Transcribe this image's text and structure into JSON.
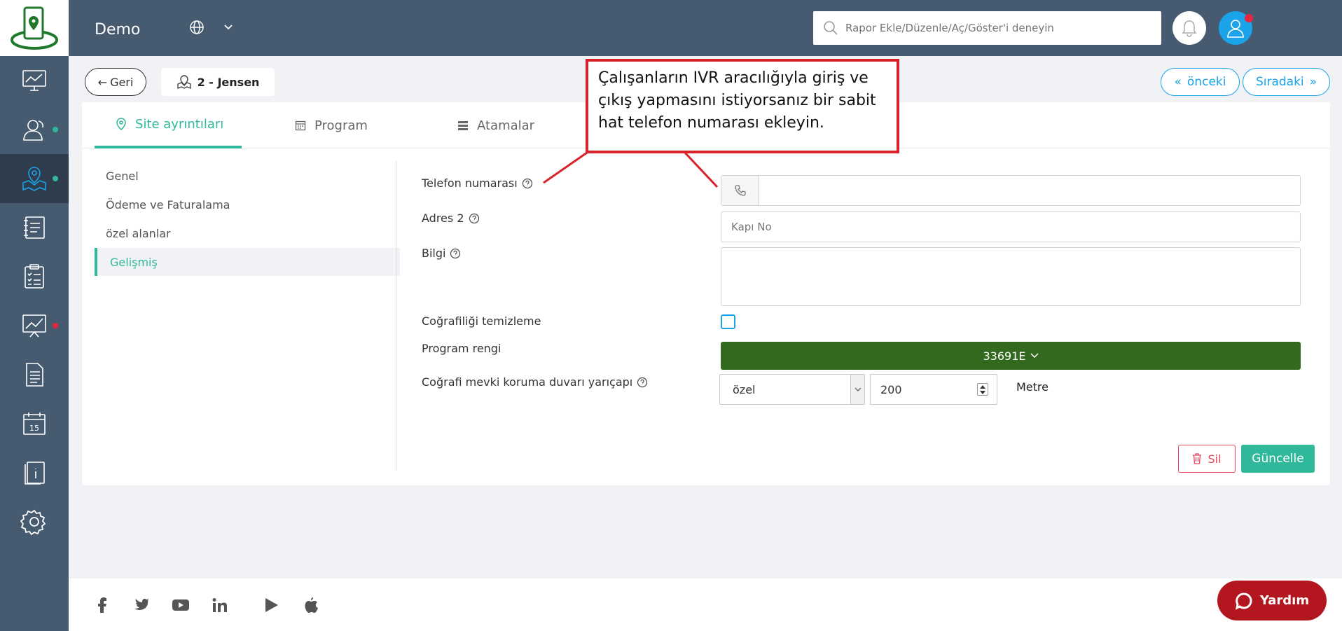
{
  "topbar": {
    "brand": "Demo",
    "search_placeholder": "Rapor Ekle/Düzenle/Aç/Göster'i deneyin"
  },
  "header": {
    "back_label": "Geri",
    "site_name": "2 - Jensen",
    "prev_label": "önceki",
    "next_label": "Sıradaki"
  },
  "tabs": [
    {
      "label": "Site ayrıntıları",
      "icon": "location-pin-icon"
    },
    {
      "label": "Program",
      "icon": "calendar-icon"
    },
    {
      "label": "Atamalar",
      "icon": "list-icon"
    }
  ],
  "left_menu": [
    "Genel",
    "Ödeme ve Faturalama",
    "özel alanlar",
    "Gelişmiş"
  ],
  "form": {
    "phone_label": "Telefon numarası",
    "phone_value": "",
    "address2_label": "Adres 2",
    "address2_placeholder": "Kapı No",
    "info_label": "Bilgi",
    "geo_clear_label": "Coğrafiliği temizleme",
    "geo_clear_checked": false,
    "color_label": "Program rengi",
    "color_value": "33691E",
    "geofence_label": "Coğrafi mevki koruma duvarı yarıçapı",
    "geofence_type": "özel",
    "geofence_value": "200",
    "unit": "Metre"
  },
  "actions": {
    "delete_label": "Sil",
    "update_label": "Güncelle"
  },
  "callout": {
    "lines": [
      "Çalışanların IVR aracılığıyla giriş ve",
      "çıkış yapmasını istiyorsanız bir sabit",
      "hat telefon numarası ekleyin."
    ]
  },
  "help_button": "Yardım",
  "colors": {
    "sidebar": "#465a70",
    "accent": "#2fb99a",
    "blue": "#1aa3e8",
    "program_color": "#33691e",
    "danger": "#e8455e",
    "callout_border": "#d8232a",
    "help_bg": "#b3161e"
  }
}
